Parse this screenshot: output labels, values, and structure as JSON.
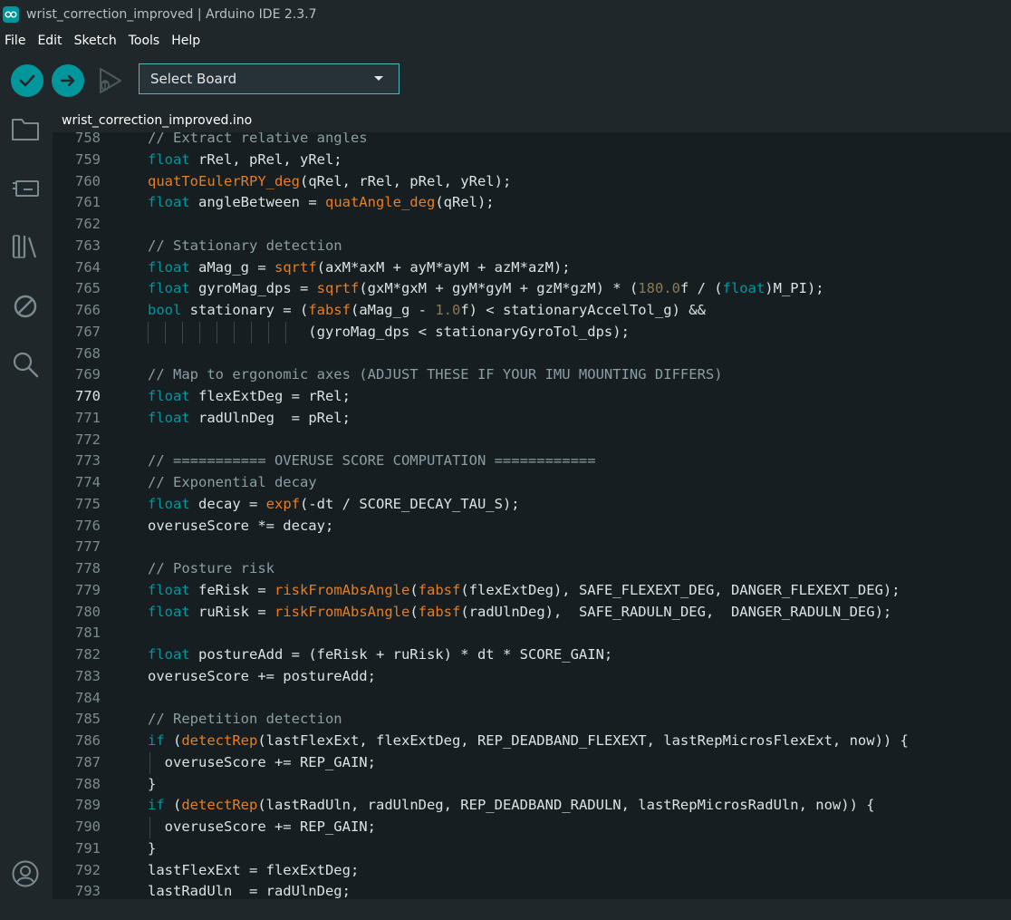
{
  "window": {
    "title": "wrist_correction_improved | Arduino IDE 2.3.7"
  },
  "menu": [
    "File",
    "Edit",
    "Sketch",
    "Tools",
    "Help"
  ],
  "toolbar": {
    "verify_icon": "check-icon",
    "upload_icon": "arrow-right-icon",
    "debug_icon": "debug-icon",
    "board_select_label": "Select Board"
  },
  "sidebar": {
    "icons": [
      "folder-icon",
      "boards-icon",
      "library-icon",
      "no-entry-icon",
      "search-icon",
      "account-icon"
    ]
  },
  "tab": {
    "label": "wrist_correction_improved.ino"
  },
  "editor": {
    "active_line": "770",
    "lines": [
      {
        "n": "758",
        "parts": [
          [
            "cm",
            "// Extract relative angles"
          ]
        ]
      },
      {
        "n": "759",
        "parts": [
          [
            "kw",
            "float"
          ],
          [
            "",
            " rRel, pRel, yRel;"
          ]
        ]
      },
      {
        "n": "760",
        "parts": [
          [
            "fn",
            "quatToEulerRPY_deg"
          ],
          [
            "",
            "(qRel, rRel, pRel, yRel);"
          ]
        ]
      },
      {
        "n": "761",
        "parts": [
          [
            "kw",
            "float"
          ],
          [
            "",
            " angleBetween = "
          ],
          [
            "fn",
            "quatAngle_deg"
          ],
          [
            "",
            "(qRel);"
          ]
        ]
      },
      {
        "n": "762",
        "parts": []
      },
      {
        "n": "763",
        "parts": [
          [
            "cm",
            "// Stationary detection"
          ]
        ]
      },
      {
        "n": "764",
        "parts": [
          [
            "kw",
            "float"
          ],
          [
            "",
            " aMag_g = "
          ],
          [
            "fn",
            "sqrtf"
          ],
          [
            "",
            "(axM*axM + ayM*ayM + azM*azM);"
          ]
        ]
      },
      {
        "n": "765",
        "parts": [
          [
            "kw",
            "float"
          ],
          [
            "",
            " gyroMag_dps = "
          ],
          [
            "fn",
            "sqrtf"
          ],
          [
            "",
            "(gxM*gxM + gyM*gyM + gzM*gzM) * ("
          ],
          [
            "num",
            "180.0"
          ],
          [
            "",
            "f / ("
          ],
          [
            "kw",
            "float"
          ],
          [
            "",
            ")M_PI);"
          ]
        ]
      },
      {
        "n": "766",
        "parts": [
          [
            "kw",
            "bool"
          ],
          [
            "",
            " stationary = ("
          ],
          [
            "fn",
            "fabsf"
          ],
          [
            "",
            "(aMag_g - "
          ],
          [
            "num",
            "1.0"
          ],
          [
            "",
            "f) < stationaryAccelTol_g) &&"
          ]
        ]
      },
      {
        "n": "767",
        "parts": [
          [
            "",
            "                   (gyroMag_dps < stationaryGyroTol_dps);"
          ]
        ]
      },
      {
        "n": "768",
        "parts": []
      },
      {
        "n": "769",
        "parts": [
          [
            "cm",
            "// Map to ergonomic axes (ADJUST THESE IF YOUR IMU MOUNTING DIFFERS)"
          ]
        ]
      },
      {
        "n": "770",
        "parts": [
          [
            "kw",
            "float"
          ],
          [
            "",
            " flexExtDeg = rRel;"
          ]
        ]
      },
      {
        "n": "771",
        "parts": [
          [
            "kw",
            "float"
          ],
          [
            "",
            " radUlnDeg  = pRel;"
          ]
        ]
      },
      {
        "n": "772",
        "parts": []
      },
      {
        "n": "773",
        "parts": [
          [
            "cm",
            "// =========== OVERUSE SCORE COMPUTATION ============"
          ]
        ]
      },
      {
        "n": "774",
        "parts": [
          [
            "cm",
            "// Exponential decay"
          ]
        ]
      },
      {
        "n": "775",
        "parts": [
          [
            "kw",
            "float"
          ],
          [
            "",
            " decay = "
          ],
          [
            "fn",
            "expf"
          ],
          [
            "",
            "(-dt / SCORE_DECAY_TAU_S);"
          ]
        ]
      },
      {
        "n": "776",
        "parts": [
          [
            "",
            "overuseScore *= decay;"
          ]
        ]
      },
      {
        "n": "777",
        "parts": []
      },
      {
        "n": "778",
        "parts": [
          [
            "cm",
            "// Posture risk"
          ]
        ]
      },
      {
        "n": "779",
        "parts": [
          [
            "kw",
            "float"
          ],
          [
            "",
            " feRisk = "
          ],
          [
            "fn",
            "riskFromAbsAngle"
          ],
          [
            "",
            "("
          ],
          [
            "fn",
            "fabsf"
          ],
          [
            "",
            "(flexExtDeg), SAFE_FLEXEXT_DEG, DANGER_FLEXEXT_DEG);"
          ]
        ]
      },
      {
        "n": "780",
        "parts": [
          [
            "kw",
            "float"
          ],
          [
            "",
            " ruRisk = "
          ],
          [
            "fn",
            "riskFromAbsAngle"
          ],
          [
            "",
            "("
          ],
          [
            "fn",
            "fabsf"
          ],
          [
            "",
            "(radUlnDeg),  SAFE_RADULN_DEG,  DANGER_RADULN_DEG);"
          ]
        ]
      },
      {
        "n": "781",
        "parts": []
      },
      {
        "n": "782",
        "parts": [
          [
            "kw",
            "float"
          ],
          [
            "",
            " postureAdd = (feRisk + ruRisk) * dt * SCORE_GAIN;"
          ]
        ]
      },
      {
        "n": "783",
        "parts": [
          [
            "",
            "overuseScore += postureAdd;"
          ]
        ]
      },
      {
        "n": "784",
        "parts": []
      },
      {
        "n": "785",
        "parts": [
          [
            "cm",
            "// Repetition detection"
          ]
        ]
      },
      {
        "n": "786",
        "parts": [
          [
            "kw",
            "if"
          ],
          [
            "",
            " ("
          ],
          [
            "fn",
            "detectRep"
          ],
          [
            "",
            "(lastFlexExt, flexExtDeg, REP_DEADBAND_FLEXEXT, lastRepMicrosFlexExt, now)) {"
          ]
        ]
      },
      {
        "n": "787",
        "parts": [
          [
            "",
            "  overuseScore += REP_GAIN;"
          ]
        ]
      },
      {
        "n": "788",
        "parts": [
          [
            "",
            "}"
          ]
        ]
      },
      {
        "n": "789",
        "parts": [
          [
            "kw",
            "if"
          ],
          [
            "",
            " ("
          ],
          [
            "fn",
            "detectRep"
          ],
          [
            "",
            "(lastRadUln, radUlnDeg, REP_DEADBAND_RADULN, lastRepMicrosRadUln, now)) {"
          ]
        ]
      },
      {
        "n": "790",
        "parts": [
          [
            "",
            "  overuseScore += REP_GAIN;"
          ]
        ]
      },
      {
        "n": "791",
        "parts": [
          [
            "",
            "}"
          ]
        ]
      },
      {
        "n": "792",
        "parts": [
          [
            "",
            "lastFlexExt = flexExtDeg;"
          ]
        ]
      },
      {
        "n": "793",
        "parts": [
          [
            "",
            "lastRadUln  = radUlnDeg;"
          ]
        ]
      }
    ]
  },
  "colors": {
    "accent": "#00979c",
    "keyword": "#00979c",
    "function": "#e67e22",
    "comment": "#8b9ea3",
    "background": "#171e21"
  }
}
